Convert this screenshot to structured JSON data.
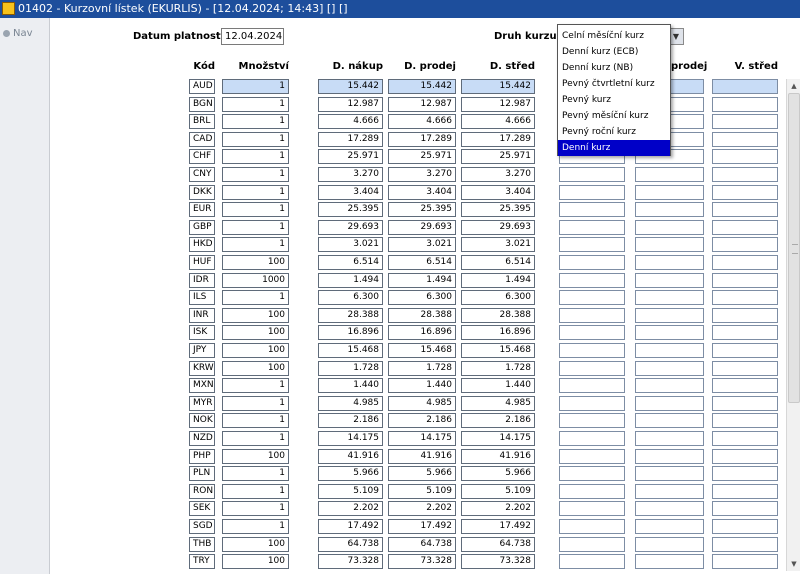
{
  "window": {
    "title": "01402 - Kurzovní lístek (EKURLIS) - [12.04.2024; 14:43] [] []"
  },
  "nav": {
    "label": "Nav"
  },
  "form": {
    "date_label": "Datum platnosti",
    "date_value": "12.04.2024",
    "rate_type_label": "Druh kurzu"
  },
  "dropdown": {
    "options": [
      "Celní měsíční kurz",
      "Denní kurz (ECB)",
      "Denní kurz (NB)",
      "Pevný čtvrtletní kurz",
      "Pevný kurz",
      "Pevný měsíční kurz",
      "Pevný roční kurz",
      "Denní kurz"
    ],
    "selected": "Denní kurz"
  },
  "columns": {
    "kod": "Kód",
    "mnozstvi": "Množství",
    "d_nakup": "D. nákup",
    "d_prodej": "D. prodej",
    "d_stred": "D. střed",
    "v_prodej": "prodej",
    "v_stred": "V. střed"
  },
  "rows": [
    {
      "kod": "AUD",
      "mnozstvi": "1",
      "nakup": "15.442",
      "prodej": "15.442",
      "stred": "15.442"
    },
    {
      "kod": "BGN",
      "mnozstvi": "1",
      "nakup": "12.987",
      "prodej": "12.987",
      "stred": "12.987"
    },
    {
      "kod": "BRL",
      "mnozstvi": "1",
      "nakup": "4.666",
      "prodej": "4.666",
      "stred": "4.666"
    },
    {
      "kod": "CAD",
      "mnozstvi": "1",
      "nakup": "17.289",
      "prodej": "17.289",
      "stred": "17.289"
    },
    {
      "kod": "CHF",
      "mnozstvi": "1",
      "nakup": "25.971",
      "prodej": "25.971",
      "stred": "25.971"
    },
    {
      "kod": "CNY",
      "mnozstvi": "1",
      "nakup": "3.270",
      "prodej": "3.270",
      "stred": "3.270"
    },
    {
      "kod": "DKK",
      "mnozstvi": "1",
      "nakup": "3.404",
      "prodej": "3.404",
      "stred": "3.404"
    },
    {
      "kod": "EUR",
      "mnozstvi": "1",
      "nakup": "25.395",
      "prodej": "25.395",
      "stred": "25.395"
    },
    {
      "kod": "GBP",
      "mnozstvi": "1",
      "nakup": "29.693",
      "prodej": "29.693",
      "stred": "29.693"
    },
    {
      "kod": "HKD",
      "mnozstvi": "1",
      "nakup": "3.021",
      "prodej": "3.021",
      "stred": "3.021"
    },
    {
      "kod": "HUF",
      "mnozstvi": "100",
      "nakup": "6.514",
      "prodej": "6.514",
      "stred": "6.514"
    },
    {
      "kod": "IDR",
      "mnozstvi": "1000",
      "nakup": "1.494",
      "prodej": "1.494",
      "stred": "1.494"
    },
    {
      "kod": "ILS",
      "mnozstvi": "1",
      "nakup": "6.300",
      "prodej": "6.300",
      "stred": "6.300"
    },
    {
      "kod": "INR",
      "mnozstvi": "100",
      "nakup": "28.388",
      "prodej": "28.388",
      "stred": "28.388"
    },
    {
      "kod": "ISK",
      "mnozstvi": "100",
      "nakup": "16.896",
      "prodej": "16.896",
      "stred": "16.896"
    },
    {
      "kod": "JPY",
      "mnozstvi": "100",
      "nakup": "15.468",
      "prodej": "15.468",
      "stred": "15.468"
    },
    {
      "kod": "KRW",
      "mnozstvi": "100",
      "nakup": "1.728",
      "prodej": "1.728",
      "stred": "1.728"
    },
    {
      "kod": "MXN",
      "mnozstvi": "1",
      "nakup": "1.440",
      "prodej": "1.440",
      "stred": "1.440"
    },
    {
      "kod": "MYR",
      "mnozstvi": "1",
      "nakup": "4.985",
      "prodej": "4.985",
      "stred": "4.985"
    },
    {
      "kod": "NOK",
      "mnozstvi": "1",
      "nakup": "2.186",
      "prodej": "2.186",
      "stred": "2.186"
    },
    {
      "kod": "NZD",
      "mnozstvi": "1",
      "nakup": "14.175",
      "prodej": "14.175",
      "stred": "14.175"
    },
    {
      "kod": "PHP",
      "mnozstvi": "100",
      "nakup": "41.916",
      "prodej": "41.916",
      "stred": "41.916"
    },
    {
      "kod": "PLN",
      "mnozstvi": "1",
      "nakup": "5.966",
      "prodej": "5.966",
      "stred": "5.966"
    },
    {
      "kod": "RON",
      "mnozstvi": "1",
      "nakup": "5.109",
      "prodej": "5.109",
      "stred": "5.109"
    },
    {
      "kod": "SEK",
      "mnozstvi": "1",
      "nakup": "2.202",
      "prodej": "2.202",
      "stred": "2.202"
    },
    {
      "kod": "SGD",
      "mnozstvi": "1",
      "nakup": "17.492",
      "prodej": "17.492",
      "stred": "17.492"
    },
    {
      "kod": "THB",
      "mnozstvi": "100",
      "nakup": "64.738",
      "prodej": "64.738",
      "stred": "64.738"
    },
    {
      "kod": "TRY",
      "mnozstvi": "100",
      "nakup": "73.328",
      "prodej": "73.328",
      "stred": "73.328"
    }
  ],
  "colors": {
    "titlebar": "#1d4e9c",
    "selected_row": "#c8dcf6",
    "dropdown_highlight": "#0000c8"
  }
}
